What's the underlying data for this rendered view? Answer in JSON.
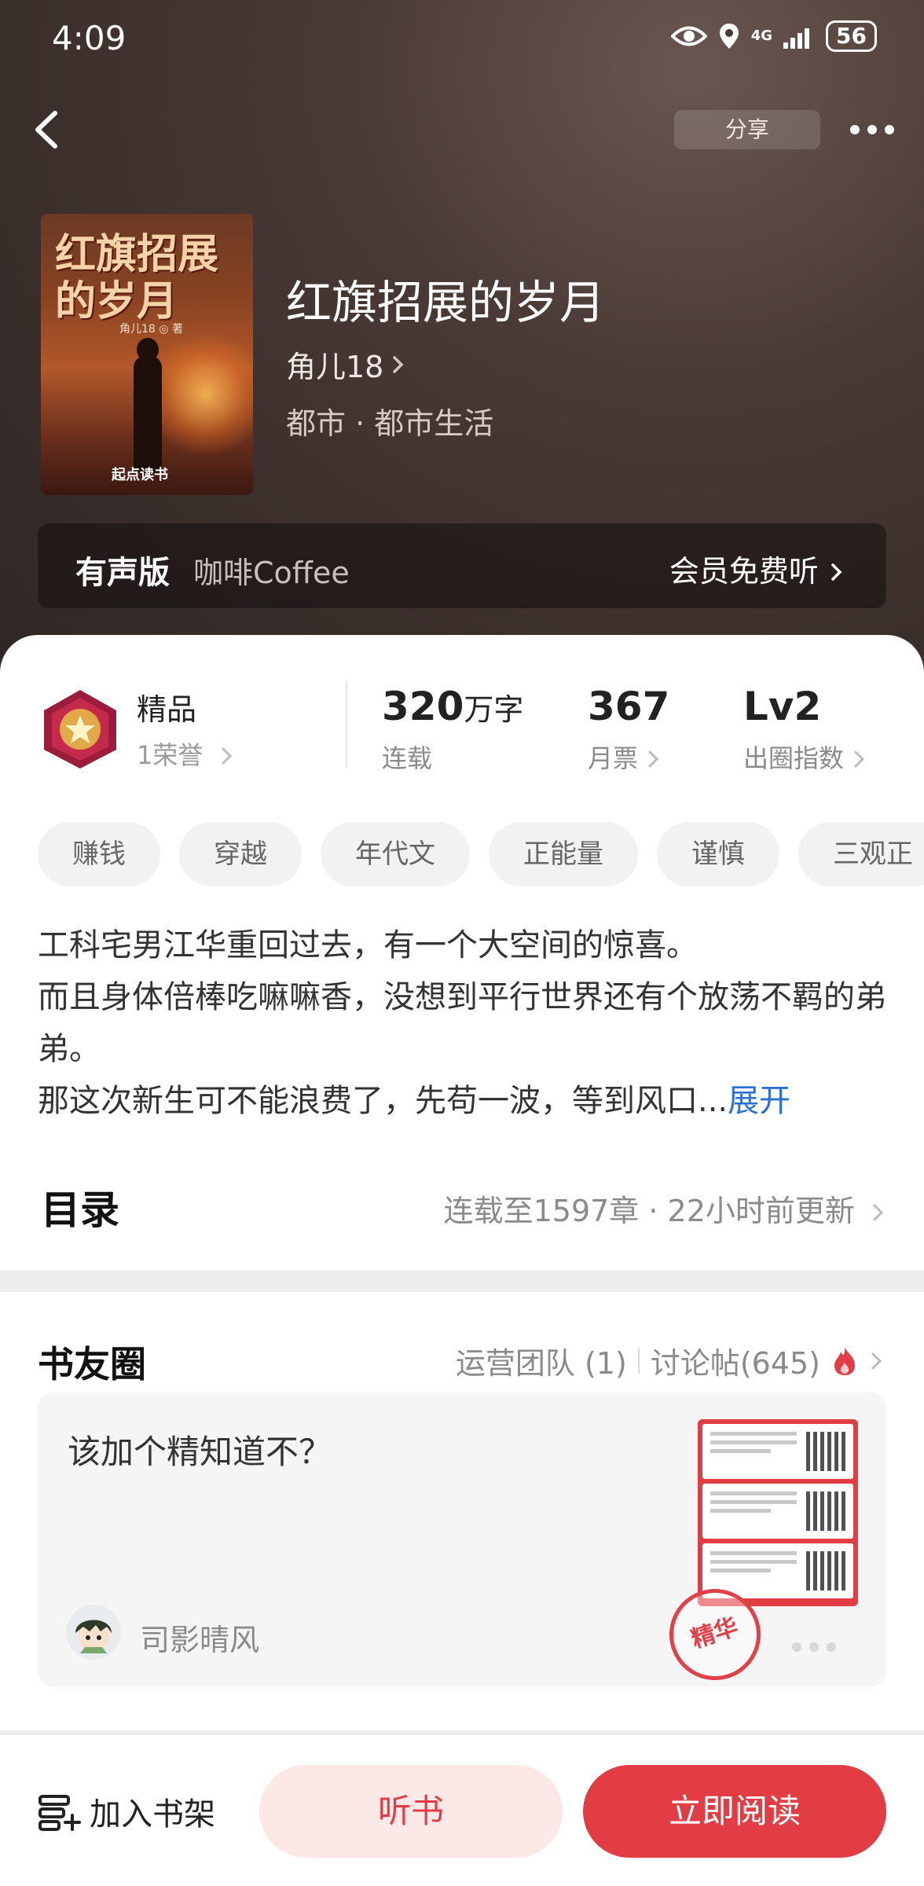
{
  "status_bar": {
    "time": "4:09",
    "network": "4G",
    "battery": "56"
  },
  "header": {
    "share_label": "分享"
  },
  "book": {
    "cover_title": "红旗招展的岁月",
    "cover_author": "角儿18 ◎ 著",
    "cover_publisher": "起点读书",
    "title": "红旗招展的岁月",
    "author": "角儿18",
    "genre": "都市 · 都市生活"
  },
  "audio": {
    "label": "有声版",
    "narrator": "咖啡Coffee",
    "cta": "会员免费听"
  },
  "honor": {
    "label": "精品",
    "sub": "1荣誉"
  },
  "stats": [
    {
      "value": "320",
      "unit": "万字",
      "label": "连载"
    },
    {
      "value": "367",
      "unit": "",
      "label": "月票"
    },
    {
      "value": "Lv2",
      "unit": "",
      "label": "出圈指数"
    }
  ],
  "tags": [
    "赚钱",
    "穿越",
    "年代文",
    "正能量",
    "谨慎",
    "三观正"
  ],
  "synopsis": {
    "lines": [
      "工科宅男江华重回过去，有一个大空间的惊喜。",
      "而且身体倍棒吃嘛嘛香，没想到平行世界还有个放荡不羁的弟弟。",
      "那这次新生可不能浪费了，先苟一波，等到风口..."
    ],
    "expand": "展开"
  },
  "toc": {
    "title": "目录",
    "info": "连载至1597章 · 22小时前更新"
  },
  "circle": {
    "title": "书友圈",
    "team": "运营团队 (1)",
    "posts_count": "讨论帖(645)",
    "post": {
      "text": "该加个精知道不？",
      "author": "司影晴风",
      "stamp": "精华"
    }
  },
  "bottom_bar": {
    "shelf": "加入书架",
    "listen": "听书",
    "read": "立即阅读"
  },
  "colors": {
    "accent": "#e23c44",
    "link": "#2a6fd6",
    "hero_bg": "#3a2e2b"
  }
}
